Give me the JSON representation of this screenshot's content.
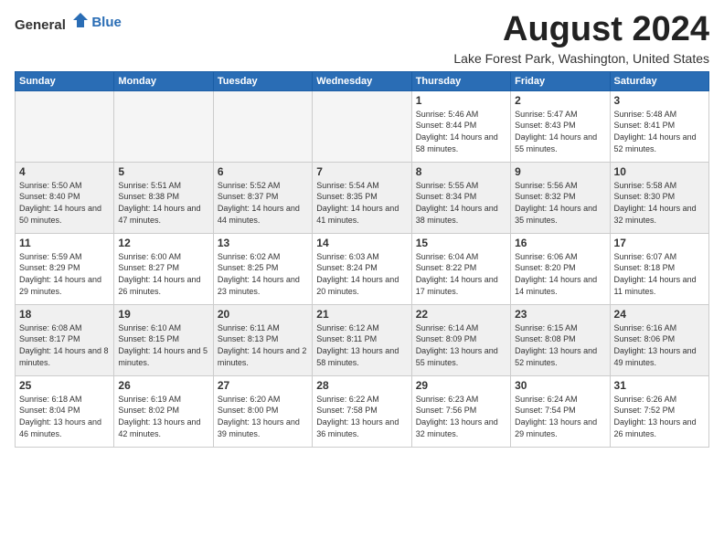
{
  "header": {
    "logo_general": "General",
    "logo_blue": "Blue",
    "month_title": "August 2024",
    "location": "Lake Forest Park, Washington, United States"
  },
  "days_of_week": [
    "Sunday",
    "Monday",
    "Tuesday",
    "Wednesday",
    "Thursday",
    "Friday",
    "Saturday"
  ],
  "weeks": [
    {
      "days": [
        {
          "num": "",
          "empty": true
        },
        {
          "num": "",
          "empty": true
        },
        {
          "num": "",
          "empty": true
        },
        {
          "num": "",
          "empty": true
        },
        {
          "num": "1",
          "sunrise": "5:46 AM",
          "sunset": "8:44 PM",
          "daylight": "14 hours and 58 minutes."
        },
        {
          "num": "2",
          "sunrise": "5:47 AM",
          "sunset": "8:43 PM",
          "daylight": "14 hours and 55 minutes."
        },
        {
          "num": "3",
          "sunrise": "5:48 AM",
          "sunset": "8:41 PM",
          "daylight": "14 hours and 52 minutes."
        }
      ]
    },
    {
      "days": [
        {
          "num": "4",
          "sunrise": "5:50 AM",
          "sunset": "8:40 PM",
          "daylight": "14 hours and 50 minutes."
        },
        {
          "num": "5",
          "sunrise": "5:51 AM",
          "sunset": "8:38 PM",
          "daylight": "14 hours and 47 minutes."
        },
        {
          "num": "6",
          "sunrise": "5:52 AM",
          "sunset": "8:37 PM",
          "daylight": "14 hours and 44 minutes."
        },
        {
          "num": "7",
          "sunrise": "5:54 AM",
          "sunset": "8:35 PM",
          "daylight": "14 hours and 41 minutes."
        },
        {
          "num": "8",
          "sunrise": "5:55 AM",
          "sunset": "8:34 PM",
          "daylight": "14 hours and 38 minutes."
        },
        {
          "num": "9",
          "sunrise": "5:56 AM",
          "sunset": "8:32 PM",
          "daylight": "14 hours and 35 minutes."
        },
        {
          "num": "10",
          "sunrise": "5:58 AM",
          "sunset": "8:30 PM",
          "daylight": "14 hours and 32 minutes."
        }
      ]
    },
    {
      "days": [
        {
          "num": "11",
          "sunrise": "5:59 AM",
          "sunset": "8:29 PM",
          "daylight": "14 hours and 29 minutes."
        },
        {
          "num": "12",
          "sunrise": "6:00 AM",
          "sunset": "8:27 PM",
          "daylight": "14 hours and 26 minutes."
        },
        {
          "num": "13",
          "sunrise": "6:02 AM",
          "sunset": "8:25 PM",
          "daylight": "14 hours and 23 minutes."
        },
        {
          "num": "14",
          "sunrise": "6:03 AM",
          "sunset": "8:24 PM",
          "daylight": "14 hours and 20 minutes."
        },
        {
          "num": "15",
          "sunrise": "6:04 AM",
          "sunset": "8:22 PM",
          "daylight": "14 hours and 17 minutes."
        },
        {
          "num": "16",
          "sunrise": "6:06 AM",
          "sunset": "8:20 PM",
          "daylight": "14 hours and 14 minutes."
        },
        {
          "num": "17",
          "sunrise": "6:07 AM",
          "sunset": "8:18 PM",
          "daylight": "14 hours and 11 minutes."
        }
      ]
    },
    {
      "days": [
        {
          "num": "18",
          "sunrise": "6:08 AM",
          "sunset": "8:17 PM",
          "daylight": "14 hours and 8 minutes."
        },
        {
          "num": "19",
          "sunrise": "6:10 AM",
          "sunset": "8:15 PM",
          "daylight": "14 hours and 5 minutes."
        },
        {
          "num": "20",
          "sunrise": "6:11 AM",
          "sunset": "8:13 PM",
          "daylight": "14 hours and 2 minutes."
        },
        {
          "num": "21",
          "sunrise": "6:12 AM",
          "sunset": "8:11 PM",
          "daylight": "13 hours and 58 minutes."
        },
        {
          "num": "22",
          "sunrise": "6:14 AM",
          "sunset": "8:09 PM",
          "daylight": "13 hours and 55 minutes."
        },
        {
          "num": "23",
          "sunrise": "6:15 AM",
          "sunset": "8:08 PM",
          "daylight": "13 hours and 52 minutes."
        },
        {
          "num": "24",
          "sunrise": "6:16 AM",
          "sunset": "8:06 PM",
          "daylight": "13 hours and 49 minutes."
        }
      ]
    },
    {
      "days": [
        {
          "num": "25",
          "sunrise": "6:18 AM",
          "sunset": "8:04 PM",
          "daylight": "13 hours and 46 minutes."
        },
        {
          "num": "26",
          "sunrise": "6:19 AM",
          "sunset": "8:02 PM",
          "daylight": "13 hours and 42 minutes."
        },
        {
          "num": "27",
          "sunrise": "6:20 AM",
          "sunset": "8:00 PM",
          "daylight": "13 hours and 39 minutes."
        },
        {
          "num": "28",
          "sunrise": "6:22 AM",
          "sunset": "7:58 PM",
          "daylight": "13 hours and 36 minutes."
        },
        {
          "num": "29",
          "sunrise": "6:23 AM",
          "sunset": "7:56 PM",
          "daylight": "13 hours and 32 minutes."
        },
        {
          "num": "30",
          "sunrise": "6:24 AM",
          "sunset": "7:54 PM",
          "daylight": "13 hours and 29 minutes."
        },
        {
          "num": "31",
          "sunrise": "6:26 AM",
          "sunset": "7:52 PM",
          "daylight": "13 hours and 26 minutes."
        }
      ]
    }
  ]
}
